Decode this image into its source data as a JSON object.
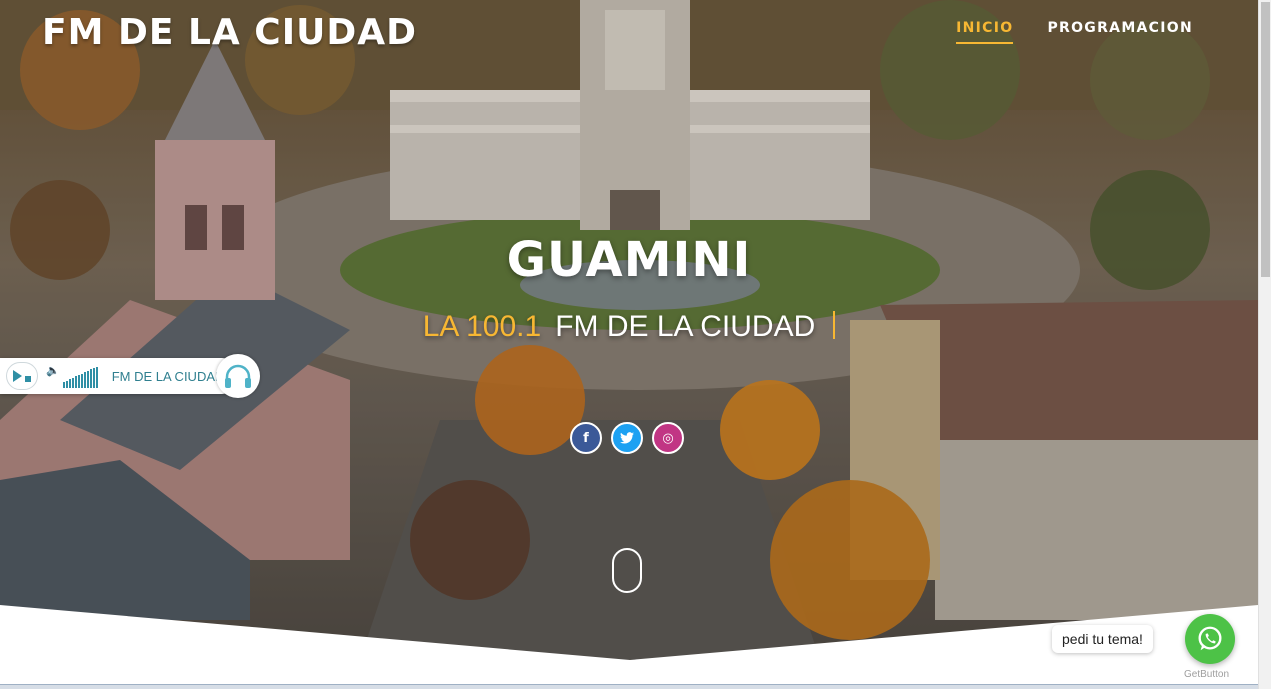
{
  "header": {
    "logo": "FM DE LA CIUDAD",
    "nav": [
      {
        "label": "INICIO",
        "active": true
      },
      {
        "label": "PROGRAMACION",
        "active": false
      }
    ]
  },
  "hero": {
    "title": "GUAMINI",
    "frequency": "LA 100.1",
    "tagline": "FM DE LA CIUDAD"
  },
  "social": {
    "icons": [
      "facebook-icon",
      "twitter-icon",
      "instagram-icon"
    ],
    "facebook_glyph": "f",
    "instagram_glyph": "◎"
  },
  "player": {
    "station_name": "FM DE LA CIUDAD",
    "volume_level": 1.0
  },
  "whatsapp": {
    "bubble_text": "pedi tu tema!",
    "credit": "GetButton"
  },
  "colors": {
    "accent": "#f7b733",
    "facebook": "#3b5998",
    "twitter": "#1da1f2",
    "instagram": "#c13584",
    "whatsapp": "#4dc247"
  }
}
